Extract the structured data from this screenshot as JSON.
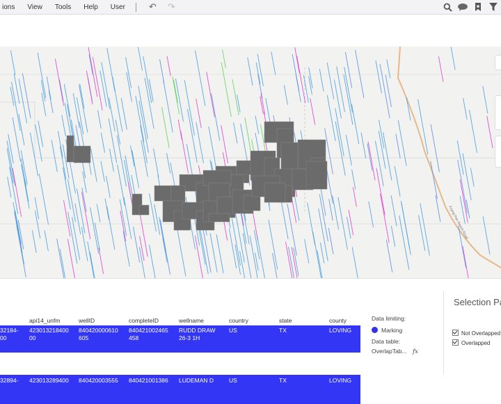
{
  "menu": {
    "items": [
      "ions",
      "View",
      "Tools",
      "Help",
      "User"
    ]
  },
  "toolbar": {
    "undo_icon": "undo-icon",
    "redo_icon": "redo-icon",
    "right_icons": [
      "search-icon",
      "comments-icon",
      "bookmark-icon",
      "filter-icon"
    ]
  },
  "map": {
    "road_label": "Frying Pan Ranch Road"
  },
  "table": {
    "headers": [
      "api14_unfm",
      "wellID",
      "completeID",
      "wellname",
      "country",
      "state",
      "county"
    ],
    "first_col_partial": [
      "32184-\n00",
      "32894-"
    ],
    "rows": [
      {
        "first": "32184-\n00",
        "api14_unfm": "423013218400\n00",
        "wellID": "840420000610\n605",
        "completeID": "840421002465\n458",
        "wellname": "RUDD DRAW\n26-3 1H",
        "country": "US",
        "state": "TX",
        "county": "LOVING"
      },
      {
        "first": "32894-",
        "api14_unfm": "423013289400",
        "wellID": "840420003555",
        "completeID": "840421001386",
        "wellname": "LUDEMAN D",
        "country": "US",
        "state": "TX",
        "county": "LOVING"
      }
    ]
  },
  "data_limiting": {
    "label": "Data limiting:",
    "marking_label": "Marking",
    "marking_color": "#2f34e6",
    "data_table_label": "Data table:",
    "data_table_value": "OverlapTab...",
    "fx": "fx"
  },
  "selection_panel": {
    "title": "Selection Pa",
    "options": [
      {
        "label": "Not Overlapped",
        "checked": true
      },
      {
        "label": "Overlapped",
        "checked": true
      }
    ]
  },
  "colors": {
    "marking": "#3336f4",
    "well_line_blue": "#4a9ee0",
    "well_line_magenta": "#e040d0",
    "well_line_green": "#5fd35f",
    "lease_gray": "#6b6b6b"
  }
}
